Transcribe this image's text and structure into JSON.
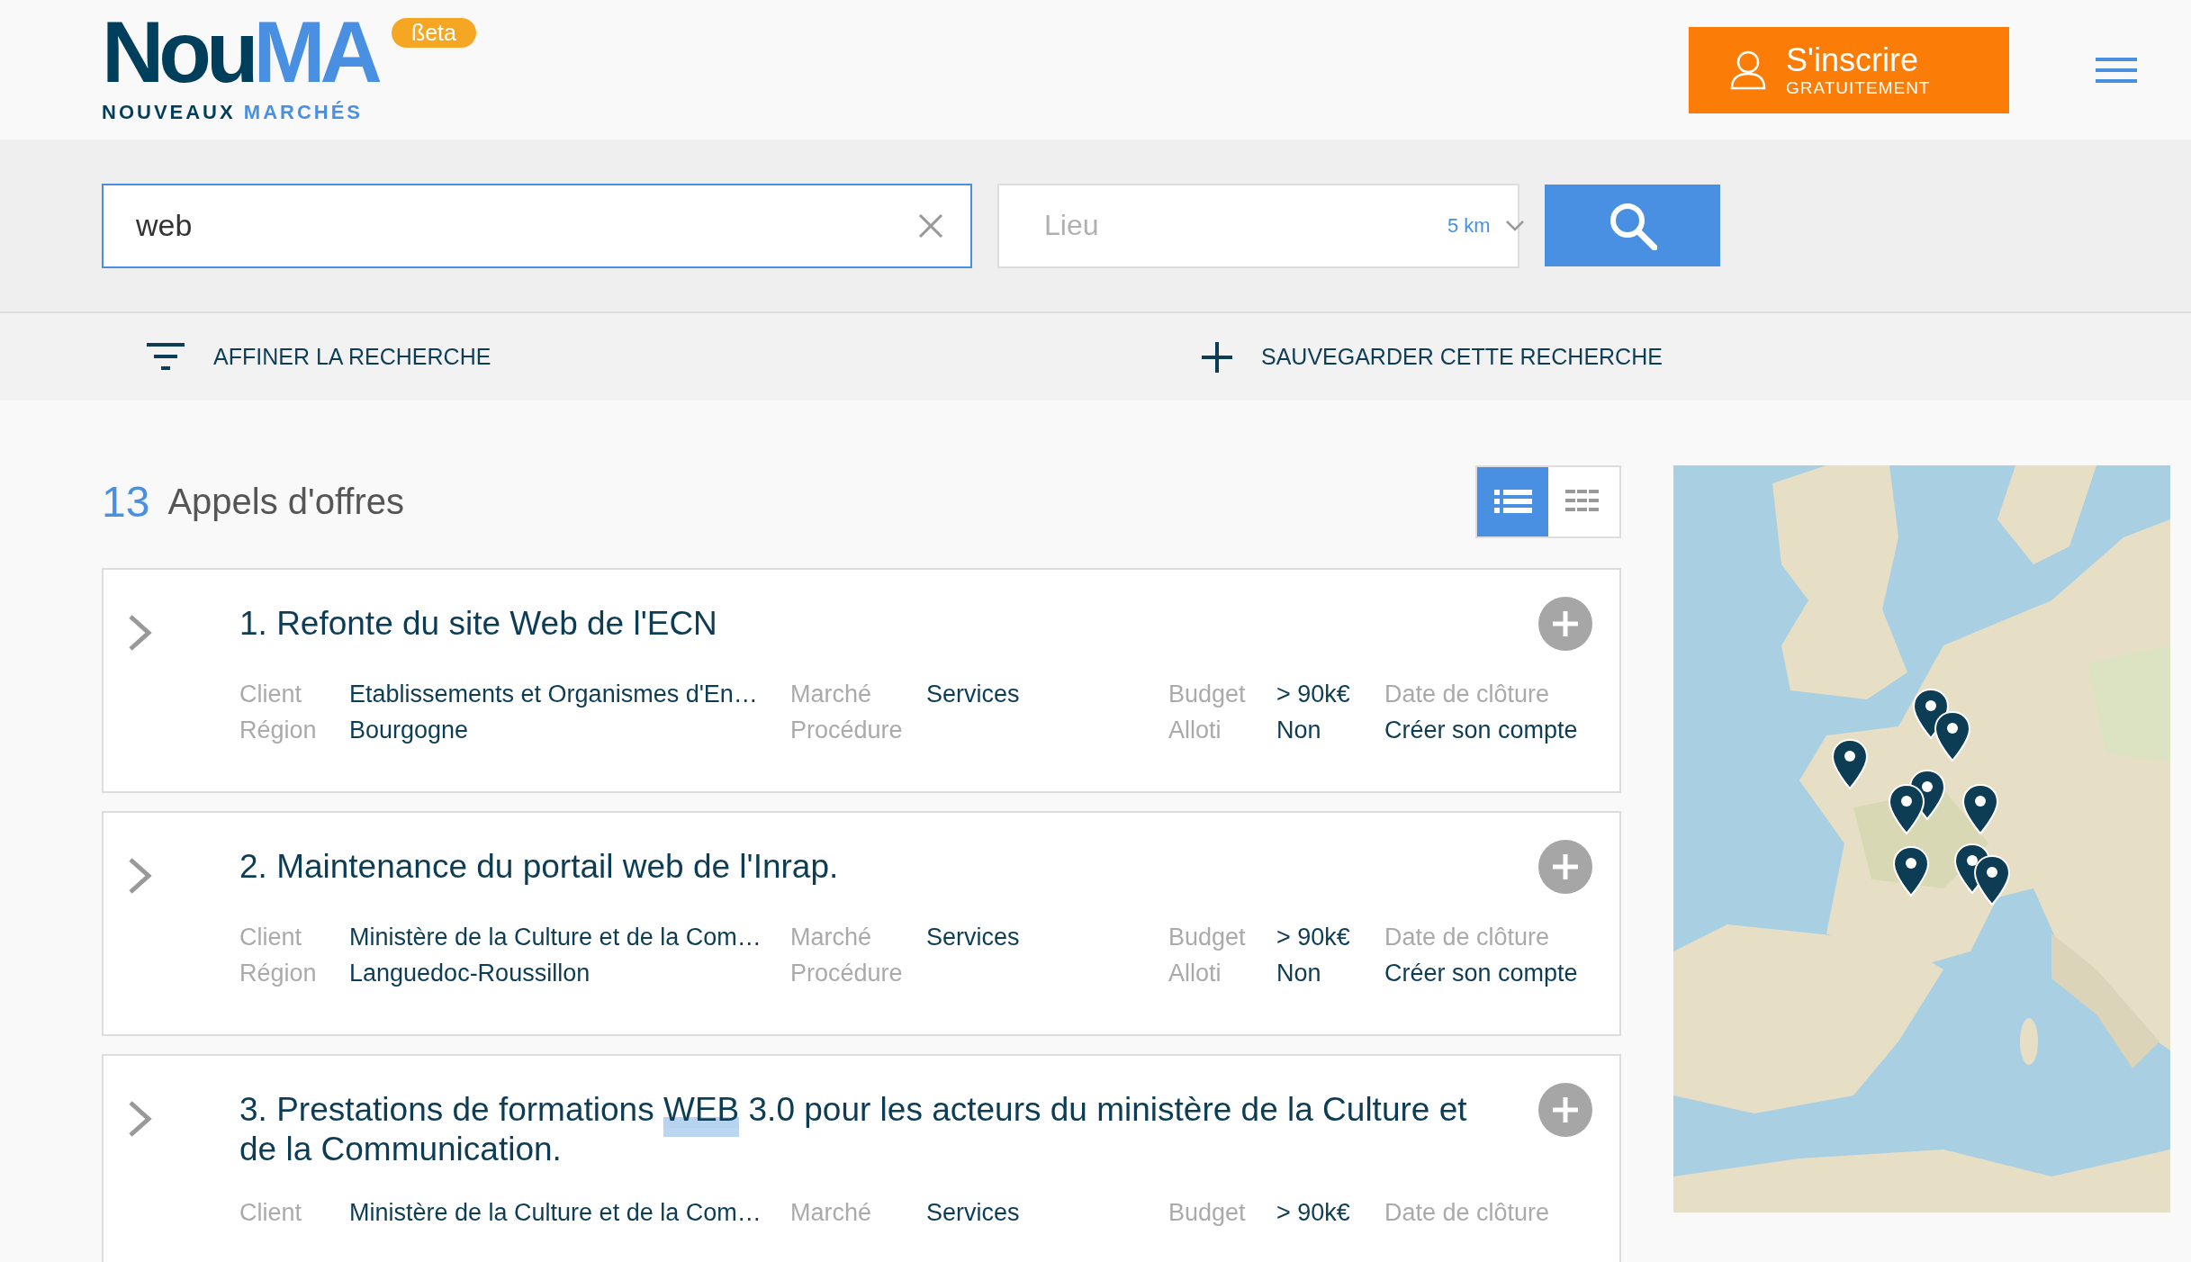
{
  "header": {
    "logo": {
      "word_dark": "Nou",
      "word_light": "MA",
      "subtitle_dark": "NOUVEAUX",
      "subtitle_light": "MARCHÉS"
    },
    "badge": "ßeta",
    "signup_button": {
      "title": "S'inscrire",
      "subtitle": "GRATUITEMENT"
    }
  },
  "search": {
    "query": "web",
    "location_placeholder": "Lieu",
    "radius": "5 km"
  },
  "actions": [
    {
      "kind": "filter",
      "label": "AFFINER LA RECHERCHE"
    },
    {
      "kind": "save",
      "label": "SAUVEGARDER CETTE RECHERCHE"
    }
  ],
  "results": {
    "count": "13",
    "label": "Appels d'offres",
    "views": [
      {
        "kind": "list",
        "selected": true
      },
      {
        "kind": "grid",
        "selected": false
      }
    ]
  },
  "tenders": [
    {
      "title_parts": [
        {
          "text": "1. Refonte du site Web de l'ECN",
          "highlight": false
        }
      ],
      "meta": [
        [
          {
            "kind": "label",
            "text": "Client"
          },
          {
            "kind": "label",
            "text": "Région"
          }
        ],
        [
          {
            "kind": "value",
            "text": "Etablissements et Organismes d'En…"
          },
          {
            "kind": "value",
            "text": "Bourgogne"
          }
        ],
        [
          {
            "kind": "label",
            "text": "Marché"
          },
          {
            "kind": "label",
            "text": "Procédure"
          }
        ],
        [
          {
            "kind": "value",
            "text": "Services"
          }
        ],
        [
          {
            "kind": "label",
            "text": "Budget"
          },
          {
            "kind": "label",
            "text": "Alloti"
          }
        ],
        [
          {
            "kind": "value",
            "text": "> 90k€"
          },
          {
            "kind": "value",
            "text": "Non"
          }
        ],
        [
          {
            "kind": "label",
            "text": "Date de clôture"
          },
          {
            "kind": "link",
            "text": "Créer son compte"
          }
        ]
      ]
    },
    {
      "title_parts": [
        {
          "text": "2. Maintenance du portail web de l'Inrap.",
          "highlight": false
        }
      ],
      "meta": [
        [
          {
            "kind": "label",
            "text": "Client"
          },
          {
            "kind": "label",
            "text": "Région"
          }
        ],
        [
          {
            "kind": "value",
            "text": "Ministère de la Culture et de la Com…"
          },
          {
            "kind": "value",
            "text": "Languedoc-Roussillon"
          }
        ],
        [
          {
            "kind": "label",
            "text": "Marché"
          },
          {
            "kind": "label",
            "text": "Procédure"
          }
        ],
        [
          {
            "kind": "value",
            "text": "Services"
          }
        ],
        [
          {
            "kind": "label",
            "text": "Budget"
          },
          {
            "kind": "label",
            "text": "Alloti"
          }
        ],
        [
          {
            "kind": "value",
            "text": "> 90k€"
          },
          {
            "kind": "value",
            "text": "Non"
          }
        ],
        [
          {
            "kind": "label",
            "text": "Date de clôture"
          },
          {
            "kind": "link",
            "text": "Créer son compte"
          }
        ]
      ]
    },
    {
      "title_parts": [
        {
          "text": "3. Prestations de formations ",
          "highlight": false
        },
        {
          "text": "WEB",
          "highlight": true
        },
        {
          "text": " 3.0 pour les acteurs du ministère de la Culture et de la Communication.",
          "highlight": false
        }
      ],
      "meta": [
        [
          {
            "kind": "label",
            "text": "Client"
          }
        ],
        [
          {
            "kind": "value",
            "text": "Ministère de la Culture et de la Com…"
          }
        ],
        [
          {
            "kind": "label",
            "text": "Marché"
          }
        ],
        [
          {
            "kind": "value",
            "text": "Services"
          }
        ],
        [
          {
            "kind": "label",
            "text": "Budget"
          }
        ],
        [
          {
            "kind": "value",
            "text": "> 90k€"
          }
        ],
        [
          {
            "kind": "label",
            "text": "Date de clôture"
          }
        ]
      ]
    }
  ]
}
